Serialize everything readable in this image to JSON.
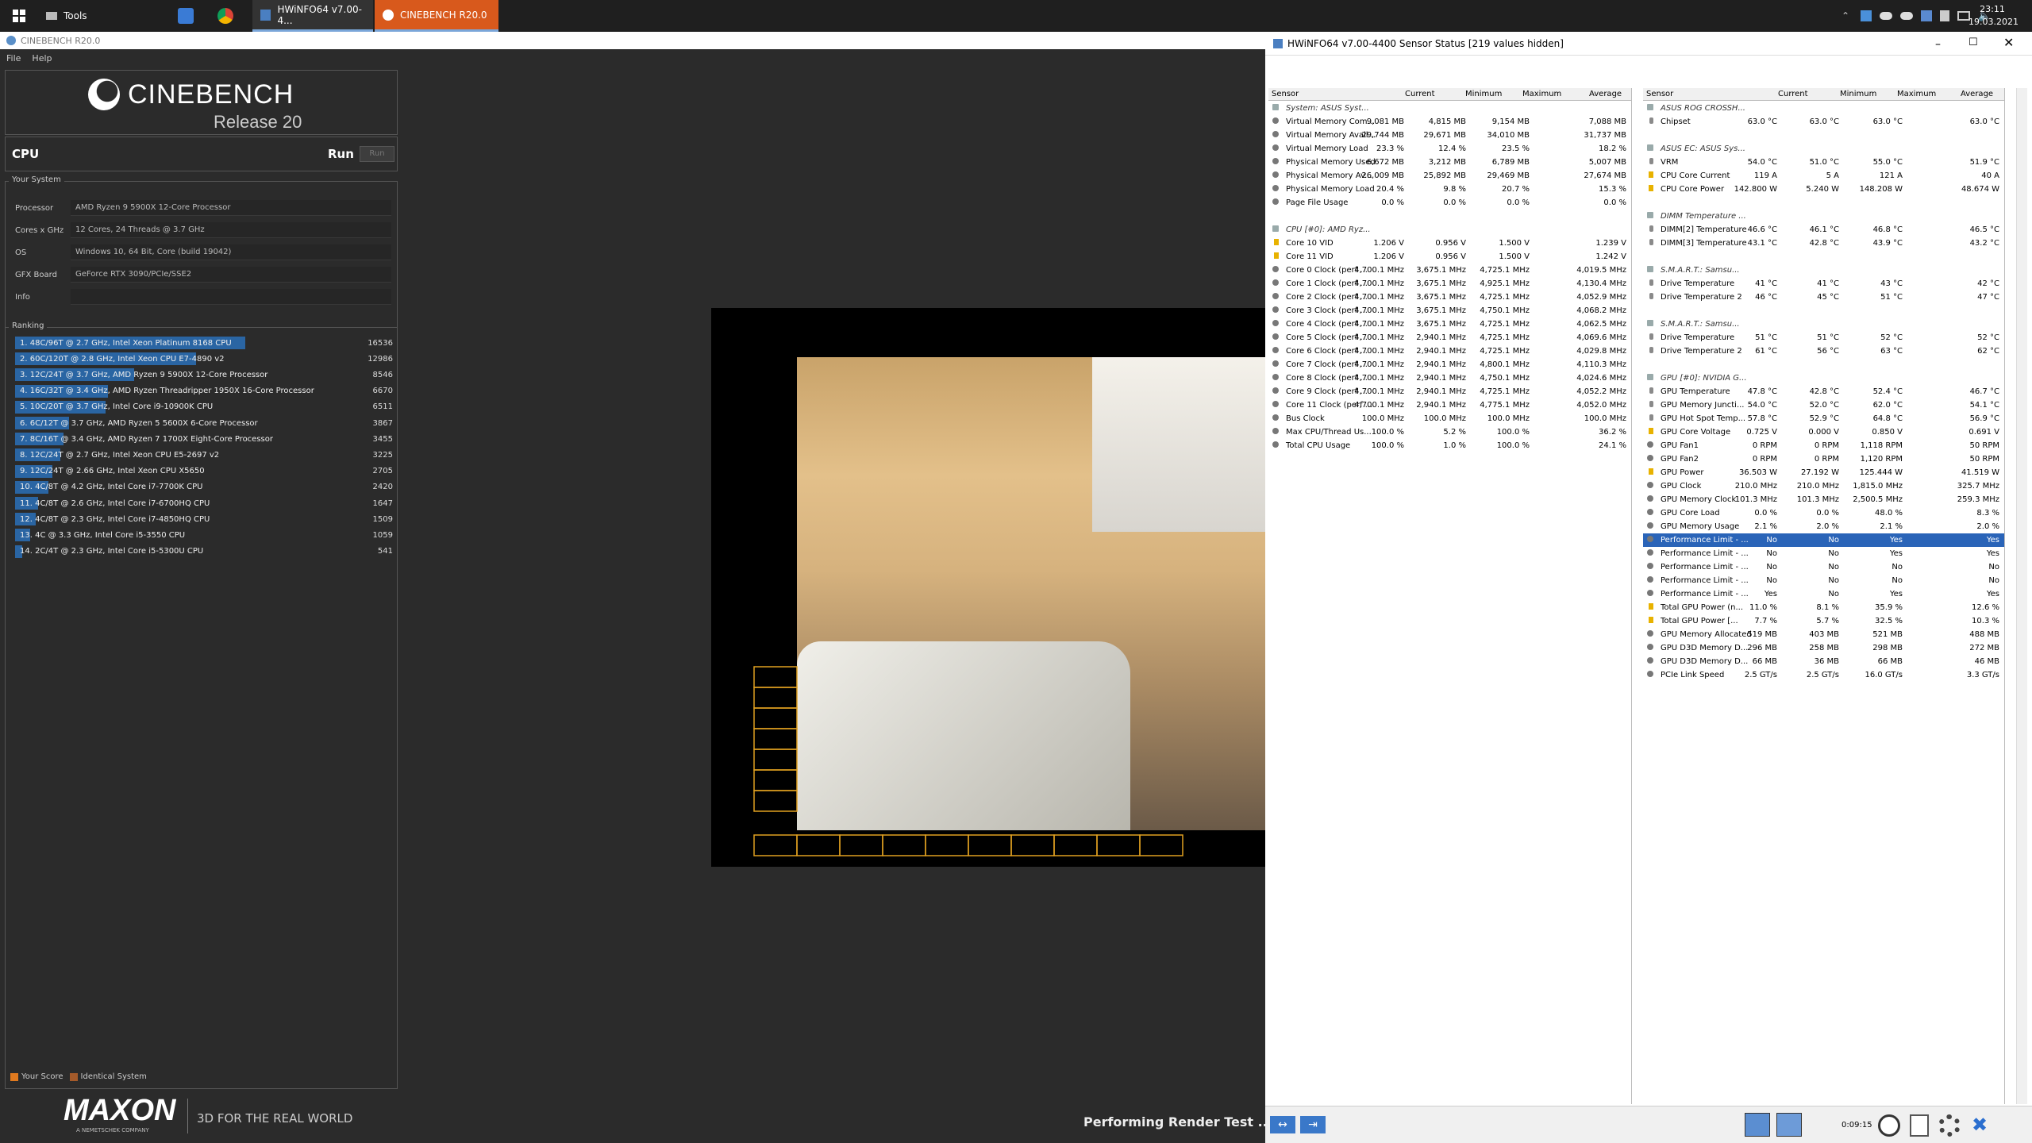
{
  "taskbar": {
    "tools_label": "Tools",
    "tabs": [
      {
        "label": "HWiNFO64 v7.00-4..."
      },
      {
        "label": "CINEBENCH R20.0"
      }
    ],
    "clock": {
      "time": "23:11",
      "date": "19.03.2021"
    }
  },
  "cinebench": {
    "window_title": "CINEBENCH R20.0",
    "menu": [
      "File",
      "Help"
    ],
    "logo": {
      "name": "CINEBENCH",
      "sub": "Release 20"
    },
    "cpu_label": "CPU",
    "run_label": "Run",
    "run_button": "Run",
    "your_system": {
      "heading": "Your System",
      "rows": [
        {
          "label": "Processor",
          "value": "AMD Ryzen 9 5900X 12-Core Processor"
        },
        {
          "label": "Cores x GHz",
          "value": "12 Cores, 24 Threads @ 3.7 GHz"
        },
        {
          "label": "OS",
          "value": "Windows 10, 64 Bit, Core (build 19042)"
        },
        {
          "label": "GFX Board",
          "value": "GeForce RTX 3090/PCIe/SSE2"
        },
        {
          "label": "Info",
          "value": ""
        }
      ]
    },
    "ranking": {
      "heading": "Ranking",
      "items": [
        {
          "text": "1. 48C/96T @ 2.7 GHz, Intel Xeon Platinum 8168 CPU",
          "score": "16536",
          "value": 16536
        },
        {
          "text": "2. 60C/120T @ 2.8 GHz, Intel Xeon CPU E7-4890 v2",
          "score": "12986",
          "value": 12986
        },
        {
          "text": "3. 12C/24T @ 3.7 GHz, AMD Ryzen 9 5900X 12-Core Processor",
          "score": "8546",
          "value": 8546
        },
        {
          "text": "4. 16C/32T @ 3.4 GHz, AMD Ryzen Threadripper 1950X 16-Core Processor",
          "score": "6670",
          "value": 6670
        },
        {
          "text": "5. 10C/20T @ 3.7 GHz, Intel Core i9-10900K CPU",
          "score": "6511",
          "value": 6511
        },
        {
          "text": "6. 6C/12T @ 3.7 GHz, AMD Ryzen 5 5600X 6-Core Processor",
          "score": "3867",
          "value": 3867
        },
        {
          "text": "7. 8C/16T @ 3.4 GHz, AMD Ryzen 7 1700X Eight-Core Processor",
          "score": "3455",
          "value": 3455
        },
        {
          "text": "8. 12C/24T @ 2.7 GHz, Intel Xeon CPU E5-2697 v2",
          "score": "3225",
          "value": 3225
        },
        {
          "text": "9. 12C/24T @ 2.66 GHz, Intel Xeon CPU X5650",
          "score": "2705",
          "value": 2705
        },
        {
          "text": "10. 4C/8T @ 4.2 GHz, Intel Core i7-7700K CPU",
          "score": "2420",
          "value": 2420
        },
        {
          "text": "11. 4C/8T @ 2.6 GHz, Intel Core i7-6700HQ CPU",
          "score": "1647",
          "value": 1647
        },
        {
          "text": "12. 4C/8T @ 2.3 GHz, Intel Core i7-4850HQ CPU",
          "score": "1509",
          "value": 1509
        },
        {
          "text": "13. 4C @ 3.3 GHz, Intel Core i5-3550 CPU",
          "score": "1059",
          "value": 1059
        },
        {
          "text": "14. 2C/4T @ 2.3 GHz, Intel Core i5-5300U CPU",
          "score": "541",
          "value": 541
        }
      ]
    },
    "legend": {
      "your_score": "Your Score",
      "identical": "Identical System"
    },
    "footer": {
      "brand": "MAXON",
      "sub": "A NEMETSCHEK COMPANY",
      "tagline": "3D FOR THE REAL WORLD"
    },
    "status": "Performing Render Test ... Ren"
  },
  "hwinfo": {
    "title": "HWiNFO64 v7.00-4400 Sensor Status [219 values hidden]",
    "columns": [
      "Sensor",
      "Current",
      "Minimum",
      "Maximum",
      "Average"
    ],
    "left_rows": [
      {
        "type": "group",
        "n": "System: ASUS Syst..."
      },
      {
        "n": "Virtual Memory Com...",
        "c": "9,081 MB",
        "mi": "4,815 MB",
        "ma": "9,154 MB",
        "a": "7,088 MB"
      },
      {
        "n": "Virtual Memory Avail...",
        "c": "29,744 MB",
        "mi": "29,671 MB",
        "ma": "34,010 MB",
        "a": "31,737 MB"
      },
      {
        "n": "Virtual Memory Load",
        "c": "23.3 %",
        "mi": "12.4 %",
        "ma": "23.5 %",
        "a": "18.2 %"
      },
      {
        "n": "Physical Memory Used",
        "c": "6,672 MB",
        "mi": "3,212 MB",
        "ma": "6,789 MB",
        "a": "5,007 MB"
      },
      {
        "n": "Physical Memory Av...",
        "c": "26,009 MB",
        "mi": "25,892 MB",
        "ma": "29,469 MB",
        "a": "27,674 MB"
      },
      {
        "n": "Physical Memory Load",
        "c": "20.4 %",
        "mi": "9.8 %",
        "ma": "20.7 %",
        "a": "15.3 %"
      },
      {
        "n": "Page File Usage",
        "c": "0.0 %",
        "mi": "0.0 %",
        "ma": "0.0 %",
        "a": "0.0 %"
      },
      {
        "type": "blank"
      },
      {
        "type": "group",
        "n": "CPU [#0]: AMD Ryz..."
      },
      {
        "n": "Core 10 VID",
        "i": "bolt",
        "c": "1.206 V",
        "mi": "0.956 V",
        "ma": "1.500 V",
        "a": "1.239 V"
      },
      {
        "n": "Core 11 VID",
        "i": "bolt",
        "c": "1.206 V",
        "mi": "0.956 V",
        "ma": "1.500 V",
        "a": "1.242 V"
      },
      {
        "n": "Core 0 Clock (perf ...",
        "c": "4,700.1 MHz",
        "mi": "3,675.1 MHz",
        "ma": "4,725.1 MHz",
        "a": "4,019.5 MHz"
      },
      {
        "n": "Core 1 Clock (perf ...",
        "c": "4,700.1 MHz",
        "mi": "3,675.1 MHz",
        "ma": "4,925.1 MHz",
        "a": "4,130.4 MHz"
      },
      {
        "n": "Core 2 Clock (perf ...",
        "c": "4,700.1 MHz",
        "mi": "3,675.1 MHz",
        "ma": "4,725.1 MHz",
        "a": "4,052.9 MHz"
      },
      {
        "n": "Core 3 Clock (perf ...",
        "c": "4,700.1 MHz",
        "mi": "3,675.1 MHz",
        "ma": "4,750.1 MHz",
        "a": "4,068.2 MHz"
      },
      {
        "n": "Core 4 Clock (perf ...",
        "c": "4,700.1 MHz",
        "mi": "3,675.1 MHz",
        "ma": "4,725.1 MHz",
        "a": "4,062.5 MHz"
      },
      {
        "n": "Core 5 Clock (perf ...",
        "c": "4,700.1 MHz",
        "mi": "2,940.1 MHz",
        "ma": "4,725.1 MHz",
        "a": "4,069.6 MHz"
      },
      {
        "n": "Core 6 Clock (perf ...",
        "c": "4,700.1 MHz",
        "mi": "2,940.1 MHz",
        "ma": "4,725.1 MHz",
        "a": "4,029.8 MHz"
      },
      {
        "n": "Core 7 Clock (perf ...",
        "c": "4,700.1 MHz",
        "mi": "2,940.1 MHz",
        "ma": "4,800.1 MHz",
        "a": "4,110.3 MHz"
      },
      {
        "n": "Core 8 Clock (perf ...",
        "c": "4,700.1 MHz",
        "mi": "2,940.1 MHz",
        "ma": "4,750.1 MHz",
        "a": "4,024.6 MHz"
      },
      {
        "n": "Core 9 Clock (perf ...",
        "c": "4,700.1 MHz",
        "mi": "2,940.1 MHz",
        "ma": "4,725.1 MHz",
        "a": "4,052.2 MHz"
      },
      {
        "n": "Core 11 Clock (perf ...",
        "c": "4,700.1 MHz",
        "mi": "2,940.1 MHz",
        "ma": "4,775.1 MHz",
        "a": "4,052.0 MHz"
      },
      {
        "n": "Bus Clock",
        "c": "100.0 MHz",
        "mi": "100.0 MHz",
        "ma": "100.0 MHz",
        "a": "100.0 MHz"
      },
      {
        "n": "Max CPU/Thread Us...",
        "c": "100.0 %",
        "mi": "5.2 %",
        "ma": "100.0 %",
        "a": "36.2 %"
      },
      {
        "n": "Total CPU Usage",
        "c": "100.0 %",
        "mi": "1.0 %",
        "ma": "100.0 %",
        "a": "24.1 %"
      }
    ],
    "right_rows": [
      {
        "type": "group",
        "n": "ASUS ROG CROSSH..."
      },
      {
        "n": "Chipset",
        "i": "therm",
        "c": "63.0 °C",
        "mi": "63.0 °C",
        "ma": "63.0 °C",
        "a": "63.0 °C"
      },
      {
        "type": "blank"
      },
      {
        "type": "group",
        "n": "ASUS EC: ASUS Sys..."
      },
      {
        "n": "VRM",
        "i": "therm",
        "c": "54.0 °C",
        "mi": "51.0 °C",
        "ma": "55.0 °C",
        "a": "51.9 °C"
      },
      {
        "n": "CPU Core Current",
        "i": "bolt",
        "c": "119 A",
        "mi": "5 A",
        "ma": "121 A",
        "a": "40 A"
      },
      {
        "n": "CPU Core Power",
        "i": "bolt",
        "c": "142.800 W",
        "mi": "5.240 W",
        "ma": "148.208 W",
        "a": "48.674 W"
      },
      {
        "type": "blank"
      },
      {
        "type": "group",
        "n": "DIMM Temperature ..."
      },
      {
        "n": "DIMM[2] Temperature",
        "i": "therm",
        "c": "46.6 °C",
        "mi": "46.1 °C",
        "ma": "46.8 °C",
        "a": "46.5 °C"
      },
      {
        "n": "DIMM[3] Temperature",
        "i": "therm",
        "c": "43.1 °C",
        "mi": "42.8 °C",
        "ma": "43.9 °C",
        "a": "43.2 °C"
      },
      {
        "type": "blank"
      },
      {
        "type": "group",
        "n": "S.M.A.R.T.: Samsu..."
      },
      {
        "n": "Drive Temperature",
        "i": "therm",
        "c": "41 °C",
        "mi": "41 °C",
        "ma": "43 °C",
        "a": "42 °C"
      },
      {
        "n": "Drive Temperature 2",
        "i": "therm",
        "c": "46 °C",
        "mi": "45 °C",
        "ma": "51 °C",
        "a": "47 °C"
      },
      {
        "type": "blank"
      },
      {
        "type": "group",
        "n": "S.M.A.R.T.: Samsu..."
      },
      {
        "n": "Drive Temperature",
        "i": "therm",
        "c": "51 °C",
        "mi": "51 °C",
        "ma": "52 °C",
        "a": "52 °C"
      },
      {
        "n": "Drive Temperature 2",
        "i": "therm",
        "c": "61 °C",
        "mi": "56 °C",
        "ma": "63 °C",
        "a": "62 °C"
      },
      {
        "type": "blank"
      },
      {
        "type": "group",
        "n": "GPU [#0]: NVIDIA G..."
      },
      {
        "n": "GPU Temperature",
        "i": "therm",
        "c": "47.8 °C",
        "mi": "42.8 °C",
        "ma": "52.4 °C",
        "a": "46.7 °C"
      },
      {
        "n": "GPU Memory Juncti...",
        "i": "therm",
        "c": "54.0 °C",
        "mi": "52.0 °C",
        "ma": "62.0 °C",
        "a": "54.1 °C"
      },
      {
        "n": "GPU Hot Spot Temp...",
        "i": "therm",
        "c": "57.8 °C",
        "mi": "52.9 °C",
        "ma": "64.8 °C",
        "a": "56.9 °C"
      },
      {
        "n": "GPU Core Voltage",
        "i": "bolt",
        "c": "0.725 V",
        "mi": "0.000 V",
        "ma": "0.850 V",
        "a": "0.691 V"
      },
      {
        "n": "GPU Fan1",
        "c": "0 RPM",
        "mi": "0 RPM",
        "ma": "1,118 RPM",
        "a": "50 RPM"
      },
      {
        "n": "GPU Fan2",
        "c": "0 RPM",
        "mi": "0 RPM",
        "ma": "1,120 RPM",
        "a": "50 RPM"
      },
      {
        "n": "GPU Power",
        "i": "bolt",
        "c": "36.503 W",
        "mi": "27.192 W",
        "ma": "125.444 W",
        "a": "41.519 W"
      },
      {
        "n": "GPU Clock",
        "c": "210.0 MHz",
        "mi": "210.0 MHz",
        "ma": "1,815.0 MHz",
        "a": "325.7 MHz"
      },
      {
        "n": "GPU Memory Clock",
        "c": "101.3 MHz",
        "mi": "101.3 MHz",
        "ma": "2,500.5 MHz",
        "a": "259.3 MHz"
      },
      {
        "n": "GPU Core Load",
        "c": "0.0 %",
        "mi": "0.0 %",
        "ma": "48.0 %",
        "a": "8.3 %"
      },
      {
        "n": "GPU Memory Usage",
        "c": "2.1 %",
        "mi": "2.0 %",
        "ma": "2.1 %",
        "a": "2.0 %"
      },
      {
        "n": "Performance Limit - ...",
        "sel": true,
        "c": "No",
        "mi": "No",
        "ma": "Yes",
        "a": "Yes"
      },
      {
        "n": "Performance Limit - ...",
        "c": "No",
        "mi": "No",
        "ma": "Yes",
        "a": "Yes"
      },
      {
        "n": "Performance Limit - ...",
        "c": "No",
        "mi": "No",
        "ma": "No",
        "a": "No"
      },
      {
        "n": "Performance Limit - ...",
        "c": "No",
        "mi": "No",
        "ma": "No",
        "a": "No"
      },
      {
        "n": "Performance Limit - ...",
        "c": "Yes",
        "mi": "No",
        "ma": "Yes",
        "a": "Yes"
      },
      {
        "n": "Total GPU Power (n...",
        "i": "bolt",
        "c": "11.0 %",
        "mi": "8.1 %",
        "ma": "35.9 %",
        "a": "12.6 %"
      },
      {
        "n": "Total GPU Power [...",
        "i": "bolt",
        "c": "7.7 %",
        "mi": "5.7 %",
        "ma": "32.5 %",
        "a": "10.3 %"
      },
      {
        "n": "GPU Memory Allocated",
        "c": "519 MB",
        "mi": "403 MB",
        "ma": "521 MB",
        "a": "488 MB"
      },
      {
        "n": "GPU D3D Memory D...",
        "c": "296 MB",
        "mi": "258 MB",
        "ma": "298 MB",
        "a": "272 MB"
      },
      {
        "n": "GPU D3D Memory D...",
        "c": "66 MB",
        "mi": "36 MB",
        "ma": "66 MB",
        "a": "46 MB"
      },
      {
        "n": "PCIe Link Speed",
        "c": "2.5 GT/s",
        "mi": "2.5 GT/s",
        "ma": "16.0 GT/s",
        "a": "3.3 GT/s"
      }
    ],
    "status_time": "0:09:15"
  }
}
